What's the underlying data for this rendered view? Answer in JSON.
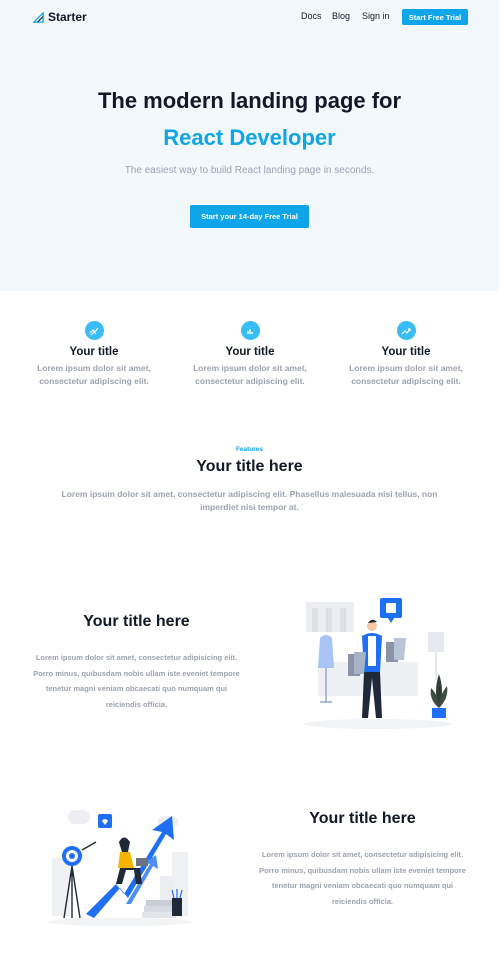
{
  "navbar": {
    "brand": "Starter",
    "links": [
      "Docs",
      "Blog",
      "Sign in"
    ],
    "cta": "Start Free Trial"
  },
  "hero": {
    "title_line1": "The modern landing page for",
    "title_line2": "React Developer",
    "subtitle": "The easiest way to build React landing page in seconds.",
    "cta": "Start your 14-day Free Trial"
  },
  "features": [
    {
      "icon": "double-arrow-icon",
      "title": "Your title",
      "text": "Lorem ipsum dolor sit amet, consectetur adipiscing elit."
    },
    {
      "icon": "chart-bars-icon",
      "title": "Your title",
      "text": "Lorem ipsum dolor sit amet, consectetur adipiscing elit."
    },
    {
      "icon": "trend-up-icon",
      "title": "Your title",
      "text": "Lorem ipsum dolor sit amet, consectetur adipiscing elit."
    }
  ],
  "section": {
    "eyebrow": "Features",
    "title": "Your title here",
    "text": "Lorem ipsum dolor sit amet, consectetur adipiscing elit. Phasellus malesuada nisi tellus, non imperdiet nisi tempor at."
  },
  "rows": [
    {
      "title": "Your title here",
      "text": "Lorem ipsum dolor sit amet, consectetur adipisicing elit. Porro minus, quibusdam nobis ullam iste eveniet tempore tenetur magni veniam obcaecati quo numquam qui reiciendis officia."
    },
    {
      "title": "Your title here",
      "text": "Lorem ipsum dolor sit amet, consectetur adipisicing elit. Porro minus, quibusdam nobis ullam iste eveniet tempore tenetur magni veniam obcaecati quo numquam qui reiciendis officia."
    }
  ],
  "colors": {
    "accent": "#0ea5e9",
    "hero_bg": "#f3f8fc",
    "muted_text": "#9ca3af"
  }
}
